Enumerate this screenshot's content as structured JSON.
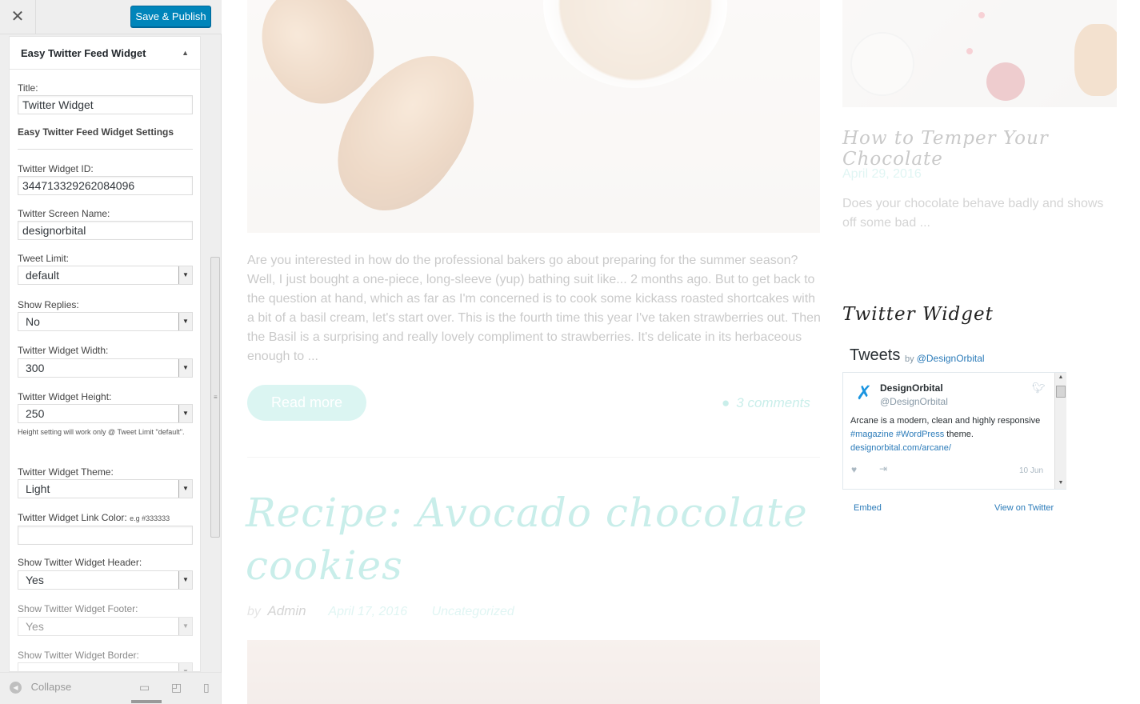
{
  "header": {
    "close_symbol": "✕",
    "save_label": "Save & Publish"
  },
  "panel": {
    "title": "Easy Twitter Feed Widget",
    "toggle_symbol": "▲",
    "fields": {
      "title_label": "Title:",
      "title_value": "Twitter Widget",
      "settings_heading": "Easy Twitter Feed Widget Settings",
      "widget_id_label": "Twitter Widget ID:",
      "widget_id_value": "344713329262084096",
      "screen_name_label": "Twitter Screen Name:",
      "screen_name_value": "designorbital",
      "tweet_limit_label": "Tweet Limit:",
      "tweet_limit_value": "default",
      "show_replies_label": "Show Replies:",
      "show_replies_value": "No",
      "width_label": "Twitter Widget Width:",
      "width_value": "300",
      "height_label": "Twitter Widget Height:",
      "height_value": "250",
      "height_hint": "Height setting will work only @ Tweet Limit \"default\".",
      "theme_label": "Twitter Widget Theme:",
      "theme_value": "Light",
      "link_color_label": "Twitter Widget Link Color:",
      "link_color_hint": "e.g #333333",
      "link_color_value": "",
      "show_header_label": "Show Twitter Widget Header:",
      "show_header_value": "Yes",
      "show_footer_label": "Show Twitter Widget Footer:",
      "show_footer_value": "Yes",
      "show_border_label": "Show Twitter Widget Border:"
    }
  },
  "footer": {
    "collapse_label": "Collapse",
    "collapse_symbol": "◀",
    "devices": [
      "desktop-icon",
      "tablet-icon",
      "mobile-icon"
    ]
  },
  "preview": {
    "post_excerpt": "Are you interested in how do the professional bakers go about preparing for the summer season? Well, I just bought a one-piece, long-sleeve (yup) bathing suit like... 2 months ago. But to get back to the question at hand, which as far as I'm concerned is to cook some kickass roasted shortcakes with a bit of a basil cream, let's start over. This is the fourth time this year I've taken strawberries out. Then the Basil is a surprising and really lovely compliment to strawberries. It's delicate in its herbaceous enough to ...",
    "read_more": "Read more",
    "comments": "3 comments",
    "post2_title": "Recipe: Avocado chocolate cookies",
    "post2_by": "by",
    "post2_author": "Admin",
    "post2_date": "April 17, 2016",
    "post2_category": "Uncategorized",
    "side_title": "How to Temper Your Chocolate",
    "side_date": "April 29, 2016",
    "side_excerpt": "Does your chocolate behave badly and shows off some bad ..."
  },
  "twitter_widget": {
    "heading": "Twitter Widget",
    "tweets_label": "Tweets",
    "by_label": "by",
    "by_handle": "@DesignOrbital",
    "tweet": {
      "name": "DesignOrbital",
      "handle": "@DesignOrbital",
      "text_before": "Arcane is a modern, clean and highly responsive ",
      "tag1": "#magazine",
      "tag2": "#WordPress",
      "text_after": " theme.",
      "link": "designorbital.com/arcane/",
      "date": "10 Jun"
    },
    "embed_label": "Embed",
    "view_label": "View on Twitter"
  },
  "colors": {
    "primary_button": "#0085ba",
    "accent_teal": "#57c8bc",
    "twitter_blue": "#1b95e0",
    "link_blue": "#2b7bb9"
  }
}
